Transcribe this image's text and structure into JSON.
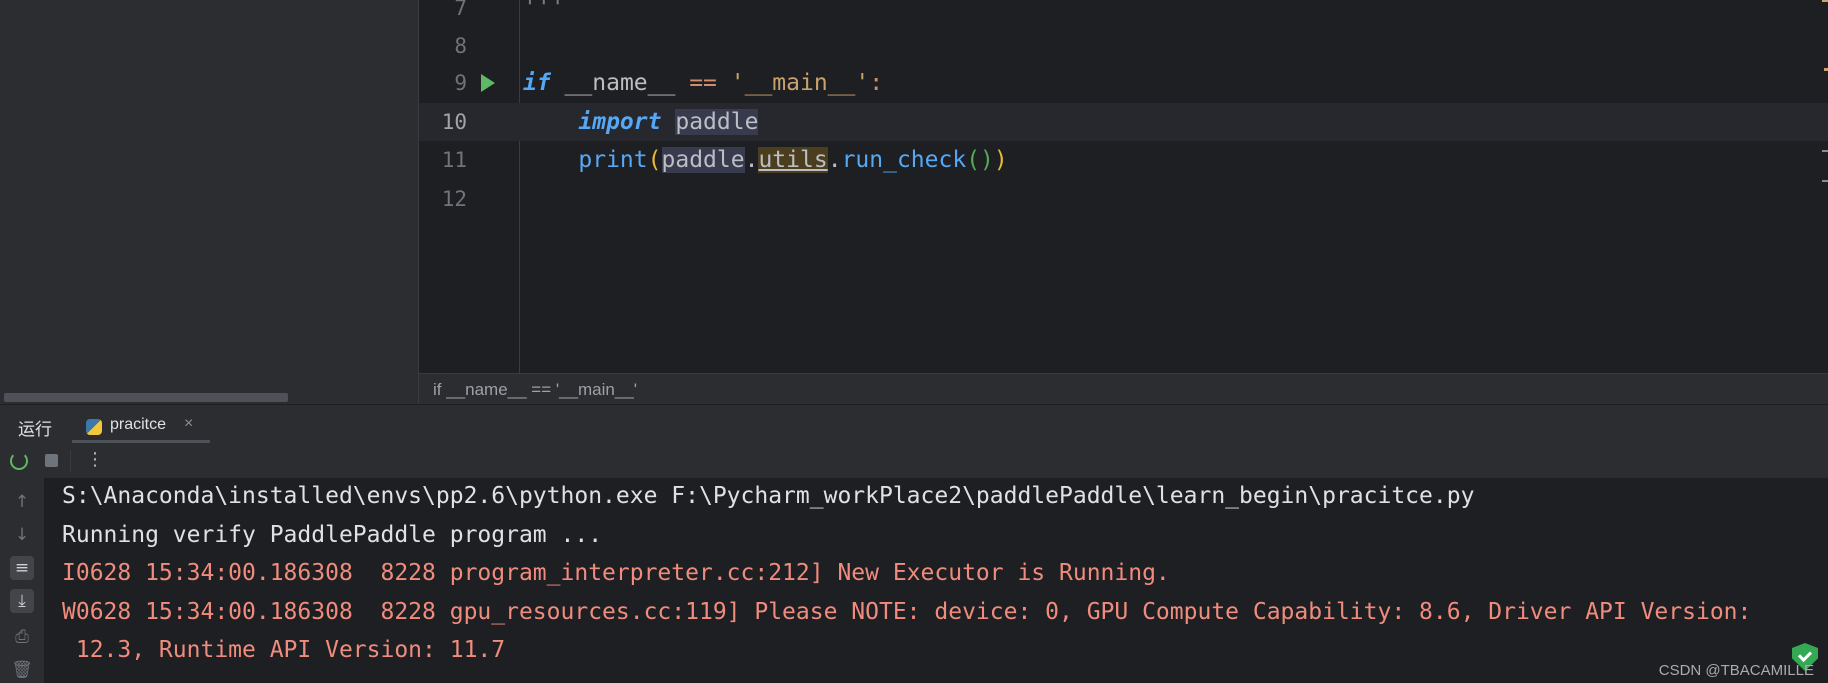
{
  "editor": {
    "lines": [
      {
        "number": "7",
        "tokens": [
          {
            "cls": "dimcomment",
            "text": "'''"
          }
        ]
      },
      {
        "number": "8",
        "tokens": []
      },
      {
        "number": "9",
        "tokens": [
          {
            "cls": "kw",
            "text": "if"
          },
          {
            "cls": "",
            "text": " __name__ "
          },
          {
            "cls": "op",
            "text": "=="
          },
          {
            "cls": "",
            "text": " "
          },
          {
            "cls": "strq",
            "text": "'__main__'"
          },
          {
            "cls": "op",
            "text": ":"
          }
        ]
      },
      {
        "number": "10",
        "tokens": [
          {
            "cls": "",
            "text": "    "
          },
          {
            "cls": "kw",
            "text": "import"
          },
          {
            "cls": "",
            "text": " "
          },
          {
            "cls": "hl",
            "text": "paddle"
          }
        ]
      },
      {
        "number": "11",
        "tokens": [
          {
            "cls": "",
            "text": "    "
          },
          {
            "cls": "fn",
            "text": "print"
          },
          {
            "cls": "paren1",
            "text": "("
          },
          {
            "cls": "hl",
            "text": "paddle"
          },
          {
            "cls": "",
            "text": "."
          },
          {
            "cls": "hlu",
            "text": "utils"
          },
          {
            "cls": "",
            "text": "."
          },
          {
            "cls": "fn",
            "text": "run_check"
          },
          {
            "cls": "paren2",
            "text": "()"
          },
          {
            "cls": "paren1",
            "text": ")"
          }
        ]
      },
      {
        "number": "12",
        "tokens": []
      }
    ],
    "breadcrumb": "if __name__ == '__main__'"
  },
  "run_panel": {
    "title": "运行",
    "tab_label": "pracitce",
    "tab_close": "×",
    "more": "⋮"
  },
  "console": {
    "lines": [
      {
        "color": "white",
        "text": "S:\\Anaconda\\installed\\envs\\pp2.6\\python.exe F:\\Pycharm_workPlace2\\paddlePaddle\\learn_begin\\pracitce.py"
      },
      {
        "color": "white",
        "text": "Running verify PaddlePaddle program ..."
      },
      {
        "color": "red",
        "text": "I0628 15:34:00.186308  8228 program_interpreter.cc:212] New Executor is Running."
      },
      {
        "color": "red",
        "text": "W0628 15:34:00.186308  8228 gpu_resources.cc:119] Please NOTE: device: 0, GPU Compute Capability: 8.6, Driver API Version:"
      },
      {
        "color": "red",
        "text": " 12.3, Runtime API Version: 11.7"
      }
    ]
  },
  "watermark": "CSDN @TBACAMILLE",
  "colors": {
    "run_green": "#5fb865",
    "error_text": "#f08c7d",
    "keyword": "#56a8f5"
  }
}
